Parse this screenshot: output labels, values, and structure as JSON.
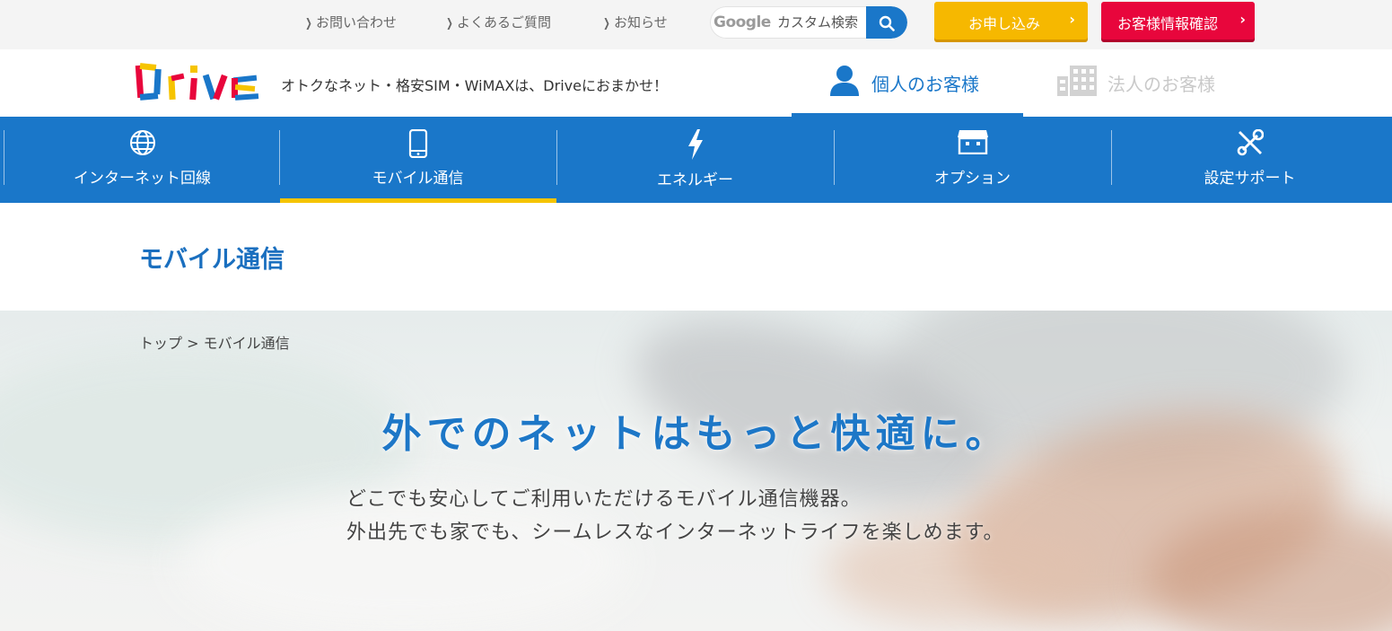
{
  "utility": {
    "links": [
      {
        "label": "お問い合わせ"
      },
      {
        "label": "よくあるご質問"
      },
      {
        "label": "お知らせ"
      }
    ],
    "search": {
      "brand": "Google",
      "placeholder": "カスタム検索"
    },
    "apply_label": "お申し込み",
    "customer_info_label": "お客様情報確認"
  },
  "brand": {
    "logo_text": "Drive",
    "tagline": "オトクなネット・格安SIM・WiMAXは、Driveにおまかせ！",
    "segments": {
      "personal": "個人のお客様",
      "corporate": "法人のお客様"
    }
  },
  "nav": {
    "items": [
      {
        "label": "インターネット回線",
        "icon": "globe-icon"
      },
      {
        "label": "モバイル通信",
        "icon": "smartphone-icon"
      },
      {
        "label": "エネルギー",
        "icon": "lightning-icon"
      },
      {
        "label": "オプション",
        "icon": "store-icon"
      },
      {
        "label": "設定サポート",
        "icon": "tools-icon"
      }
    ],
    "active_index": 1
  },
  "page": {
    "title": "モバイル通信"
  },
  "breadcrumb": {
    "home": "トップ",
    "separator": " > ",
    "current": "モバイル通信"
  },
  "hero": {
    "heading": "外でのネットはもっと快適に。",
    "lines": [
      "どこでも安心してご利用いただけるモバイル通信機器。",
      "外出先でも家でも、シームレスなインターネットライフを楽しめます。"
    ]
  },
  "colors": {
    "primary": "#1a77c9",
    "accent_yellow": "#f6b800",
    "accent_red": "#e8063c"
  }
}
